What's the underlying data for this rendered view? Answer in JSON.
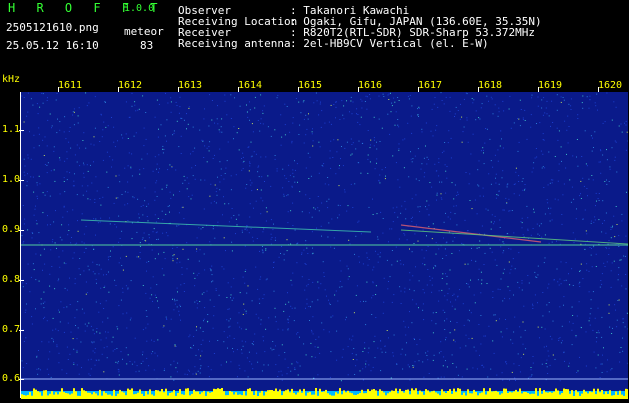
{
  "header": {
    "brand": "H R O F F T",
    "version": "1.0.0",
    "filename": "2505121610.png",
    "detection_type": "meteor",
    "datetime": "25.05.12 16:10",
    "count": "83"
  },
  "info": [
    {
      "key": "Observer",
      "value": ": Takanori Kawachi"
    },
    {
      "key": "Receiving Location",
      "value": ": Ogaki, Gifu, JAPAN (136.60E, 35.35N)"
    },
    {
      "key": "Receiver",
      "value": ": R820T2(RTL-SDR) SDR-Sharp 53.372MHz"
    },
    {
      "key": "Receiving antenna",
      "value": ": 2el-HB9CV Vertical (el. E-W)"
    }
  ],
  "spectrogram": {
    "y_unit": "kHz",
    "y_labels": [
      "1.1",
      "1.0",
      "0.9",
      "0.8",
      "0.7",
      "0.6"
    ],
    "x_labels": [
      "1611",
      "1612",
      "1613",
      "1614",
      "1615",
      "1616",
      "1617",
      "1618",
      "1619",
      "1620"
    ],
    "colors": {
      "background": "#0a1a8a",
      "axis_text": "#ffff00",
      "tick": "#ffffff",
      "header_green": "#33ff33"
    }
  }
}
